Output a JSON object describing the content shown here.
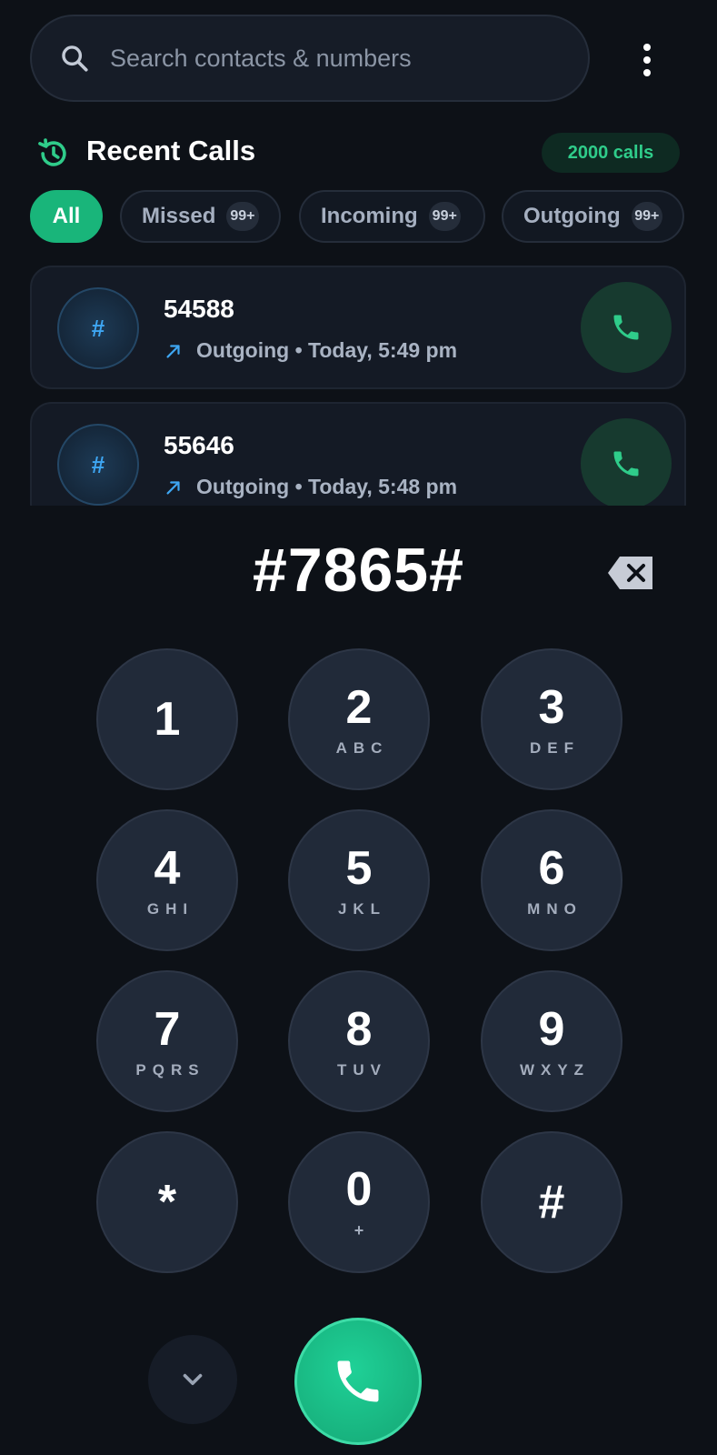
{
  "search": {
    "placeholder": "Search contacts & numbers",
    "icon": "search-icon"
  },
  "header": {
    "title": "Recent Calls",
    "calls_badge": "2000 calls",
    "icon": "history-icon"
  },
  "filters": [
    {
      "label": "All",
      "active": true
    },
    {
      "label": "Missed",
      "count": "99+"
    },
    {
      "label": "Incoming",
      "count": "99+"
    },
    {
      "label": "Outgoing",
      "count": "99+"
    }
  ],
  "calls": [
    {
      "avatar": "#",
      "number": "54588",
      "direction": "Outgoing",
      "time": "Today, 5:49 pm"
    },
    {
      "avatar": "#",
      "number": "55646",
      "direction": "Outgoing",
      "time": "Today, 5:48 pm"
    }
  ],
  "dialer": {
    "number": "#7865#",
    "keys": [
      {
        "digit": "1",
        "letters": ""
      },
      {
        "digit": "2",
        "letters": "ABC"
      },
      {
        "digit": "3",
        "letters": "DEF"
      },
      {
        "digit": "4",
        "letters": "GHI"
      },
      {
        "digit": "5",
        "letters": "JKL"
      },
      {
        "digit": "6",
        "letters": "MNO"
      },
      {
        "digit": "7",
        "letters": "PQRS"
      },
      {
        "digit": "8",
        "letters": "TUV"
      },
      {
        "digit": "9",
        "letters": "WXYZ"
      },
      {
        "digit": "*",
        "letters": ""
      },
      {
        "digit": "0",
        "letters": "+"
      },
      {
        "digit": "#",
        "letters": ""
      }
    ]
  },
  "colors": {
    "background": "#0d1117",
    "accent": "#19b57a",
    "avatar_text": "#3ea6f2",
    "key": "#212a39"
  }
}
